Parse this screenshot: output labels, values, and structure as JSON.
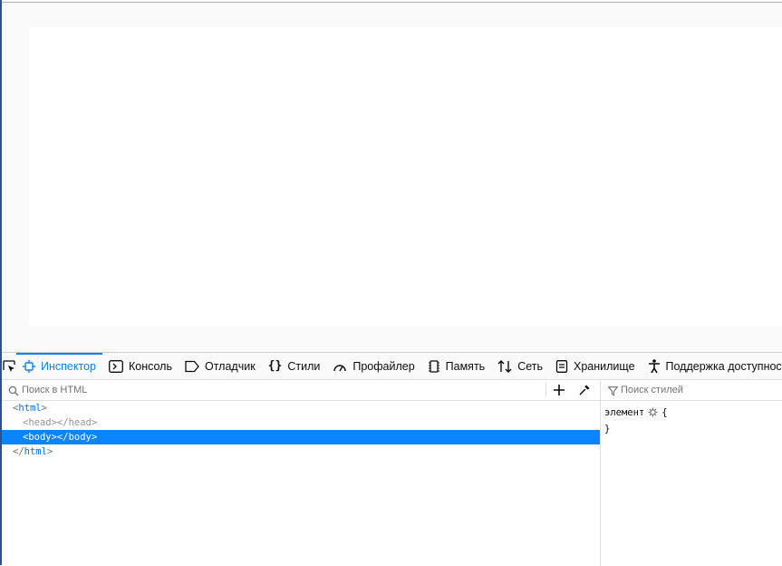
{
  "devtools": {
    "tabs": [
      {
        "label": "Инспектор",
        "icon": "inspector-icon",
        "selected": true
      },
      {
        "label": "Консоль",
        "icon": "console-icon"
      },
      {
        "label": "Отладчик",
        "icon": "debugger-icon"
      },
      {
        "label": "Стили",
        "icon": "style-editor-icon"
      },
      {
        "label": "Профайлер",
        "icon": "profiler-icon"
      },
      {
        "label": "Память",
        "icon": "memory-icon"
      },
      {
        "label": "Сеть",
        "icon": "network-icon"
      },
      {
        "label": "Хранилище",
        "icon": "storage-icon"
      },
      {
        "label": "Поддержка доступности",
        "icon": "accessibility-icon"
      }
    ],
    "accent_color": "#0a84ff"
  },
  "inspector": {
    "search_placeholder": "Поиск в HTML",
    "markup": {
      "html_open": "html",
      "head": "<head></head>",
      "body": "<body></body>",
      "html_close": "html"
    }
  },
  "rules": {
    "filter_placeholder": "Поиск стилей",
    "element_selector": "элемент",
    "open_brace": "{",
    "close_brace": "}"
  }
}
